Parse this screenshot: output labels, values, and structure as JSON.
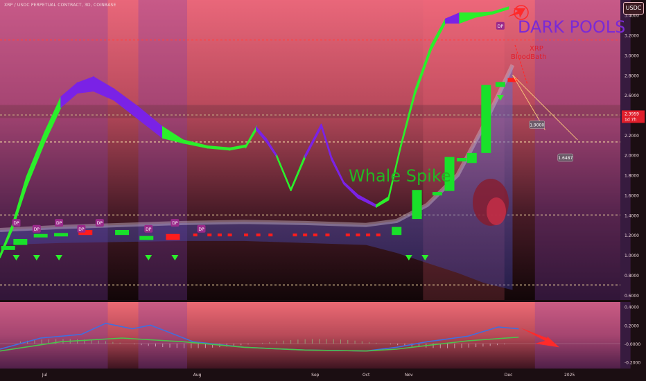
{
  "header": {
    "title": "XRP / USDC PERPETUAL CONTRACT, 3D, COINBASE",
    "currency": "USDC"
  },
  "annotations": {
    "dark_pools": "DARK POOLS",
    "xrp": "XRP",
    "bloodbath": "BloodBath",
    "whale_spike": "Whale Spike",
    "dp": "DP"
  },
  "price_badge": {
    "value": "2.3959",
    "sub": "1d 7h",
    "color": "#e01e2b"
  },
  "colors": {
    "bull": "#19e02a",
    "bear": "#ff1c1c",
    "ribbon_up": "#2bef2b",
    "ribbon_down": "#7a22e6",
    "signal": "#2bef2b"
  },
  "chart_data": [
    {
      "type": "line",
      "name": "main",
      "x_labels": [
        "Jul",
        "Aug",
        "Sep",
        "Oct",
        "Nov",
        "Dec",
        "2025"
      ],
      "y_ticks": [
        0.6,
        0.8,
        1.0,
        1.2,
        1.4,
        1.6,
        1.8,
        2.0,
        2.2,
        2.4,
        2.6,
        2.8,
        3.0,
        3.2,
        3.4
      ],
      "y_tick_labels": [
        "0.6000",
        "0.8000",
        "1.0000",
        "1.2000",
        "1.4000",
        "1.6000",
        "1.8000",
        "2.0000",
        "2.2000",
        "2.4000",
        "2.6000",
        "2.8000",
        "3.0000",
        "3.2000",
        "3.4000"
      ],
      "ylim": [
        0.55,
        3.55
      ],
      "candles": [
        {
          "x": 0.4,
          "o": 1.05,
          "c": 1.09
        },
        {
          "x": 1.0,
          "o": 1.1,
          "c": 1.16
        },
        {
          "x": 2.0,
          "o": 1.19,
          "c": 1.21
        },
        {
          "x": 3.0,
          "o": 1.21,
          "c": 1.22
        },
        {
          "x": 4.2,
          "o": 1.25,
          "c": 1.2
        },
        {
          "x": 6.0,
          "o": 1.2,
          "c": 1.25
        },
        {
          "x": 7.2,
          "o": 1.15,
          "c": 1.19
        },
        {
          "x": 8.5,
          "o": 1.21,
          "c": 1.15
        },
        {
          "x": 19.5,
          "o": 1.2,
          "c": 1.28
        },
        {
          "x": 20.5,
          "o": 1.36,
          "c": 1.65
        },
        {
          "x": 21.5,
          "o": 1.6,
          "c": 1.63
        },
        {
          "x": 22.1,
          "o": 1.64,
          "c": 1.98
        },
        {
          "x": 22.7,
          "o": 1.94,
          "c": 1.97
        },
        {
          "x": 23.2,
          "o": 1.92,
          "c": 2.02
        },
        {
          "x": 23.9,
          "o": 2.02,
          "c": 2.7
        },
        {
          "x": 24.6,
          "o": 2.68,
          "c": 2.73
        },
        {
          "x": 25.2,
          "o": 2.77,
          "c": 2.73
        }
      ],
      "small_bears": [
        9.6,
        10.3,
        10.8,
        11.3,
        12.1,
        12.7,
        13.3,
        14.5,
        15.0,
        15.5,
        16.1,
        17.1,
        17.6,
        18.1,
        18.6
      ],
      "hlines": [
        {
          "y": 3.15,
          "color": "#ff4040"
        },
        {
          "y": 2.4,
          "color": "#f0d5a0"
        },
        {
          "y": 2.13,
          "color": "#f0d5a0"
        },
        {
          "y": 1.4,
          "color": "#f0d5a0"
        },
        {
          "y": 0.7,
          "color": "#f0d5a0"
        }
      ],
      "targets": [
        {
          "label": "1.9000",
          "x": 26.4,
          "y": 2.3
        },
        {
          "label": "1.6487",
          "x": 27.8,
          "y": 1.97
        }
      ],
      "ribbon_upper": [
        [
          0,
          1.0
        ],
        [
          0.6,
          1.3
        ],
        [
          1.3,
          1.78
        ],
        [
          2.2,
          2.23
        ],
        [
          3.0,
          2.58
        ],
        [
          3.8,
          2.72
        ],
        [
          4.6,
          2.78
        ],
        [
          5.6,
          2.66
        ],
        [
          6.8,
          2.48
        ],
        [
          8.0,
          2.28
        ],
        [
          9.0,
          2.15
        ],
        [
          10.2,
          2.09
        ],
        [
          11.3,
          2.07
        ],
        [
          12.1,
          2.1
        ],
        [
          12.6,
          2.28
        ],
        [
          13.1,
          2.16
        ],
        [
          13.6,
          2.0
        ],
        [
          14.3,
          1.66
        ],
        [
          15.0,
          2.0
        ],
        [
          15.8,
          2.31
        ],
        [
          16.3,
          1.98
        ],
        [
          16.9,
          1.73
        ],
        [
          17.6,
          1.6
        ],
        [
          18.5,
          1.5
        ],
        [
          19.1,
          1.58
        ],
        [
          19.7,
          2.1
        ],
        [
          20.4,
          2.65
        ],
        [
          21.2,
          3.1
        ],
        [
          21.9,
          3.36
        ],
        [
          22.6,
          3.42
        ],
        [
          23.4,
          3.42
        ],
        [
          24.2,
          3.43
        ],
        [
          25.0,
          3.48
        ]
      ],
      "ribbon_lower": [
        [
          0,
          0.97
        ],
        [
          0.6,
          1.25
        ],
        [
          1.3,
          1.68
        ],
        [
          2.2,
          2.13
        ],
        [
          3.0,
          2.48
        ],
        [
          3.8,
          2.62
        ],
        [
          4.6,
          2.64
        ],
        [
          5.6,
          2.55
        ],
        [
          6.8,
          2.36
        ],
        [
          8.0,
          2.17
        ],
        [
          9.0,
          2.12
        ],
        [
          10.2,
          2.07
        ],
        [
          11.3,
          2.05
        ],
        [
          12.1,
          2.08
        ],
        [
          12.6,
          2.25
        ],
        [
          13.1,
          2.13
        ],
        [
          13.6,
          1.98
        ],
        [
          14.3,
          1.64
        ],
        [
          15.0,
          1.97
        ],
        [
          15.8,
          2.28
        ],
        [
          16.3,
          1.95
        ],
        [
          16.9,
          1.71
        ],
        [
          17.6,
          1.57
        ],
        [
          18.5,
          1.48
        ],
        [
          19.1,
          1.55
        ],
        [
          19.7,
          2.07
        ],
        [
          20.4,
          2.6
        ],
        [
          21.2,
          3.05
        ],
        [
          21.9,
          3.32
        ],
        [
          22.6,
          3.32
        ],
        [
          23.4,
          3.38
        ],
        [
          24.2,
          3.41
        ],
        [
          25.0,
          3.46
        ]
      ],
      "ribbon_colors": [
        "up",
        "up",
        "up",
        "up",
        "down",
        "down",
        "down",
        "down",
        "down",
        "up",
        "up",
        "up",
        "up",
        "up",
        "down",
        "down",
        "up",
        "up",
        "down",
        "down",
        "down",
        "down",
        "down",
        "up",
        "up",
        "up",
        "up",
        "up",
        "down",
        "up",
        "up",
        "up"
      ],
      "band_upper": [
        [
          0,
          1.25
        ],
        [
          3,
          1.28
        ],
        [
          6,
          1.3
        ],
        [
          9,
          1.32
        ],
        [
          12,
          1.33
        ],
        [
          15,
          1.32
        ],
        [
          18,
          1.3
        ],
        [
          19.5,
          1.34
        ],
        [
          21,
          1.5
        ],
        [
          22.5,
          1.8
        ],
        [
          23.8,
          2.3
        ],
        [
          25.2,
          2.9
        ]
      ],
      "band_lower": [
        [
          0,
          1.1
        ],
        [
          3,
          1.12
        ],
        [
          6,
          1.13
        ],
        [
          9,
          1.14
        ],
        [
          12,
          1.14
        ],
        [
          15,
          1.12
        ],
        [
          18,
          1.1
        ],
        [
          19.5,
          1.02
        ],
        [
          21,
          0.92
        ],
        [
          22.5,
          0.82
        ],
        [
          23.8,
          0.72
        ],
        [
          25.2,
          0.65
        ]
      ]
    },
    {
      "type": "line",
      "name": "oscillator",
      "y_ticks": [
        0.4,
        0.2,
        0.0,
        -0.2
      ],
      "y_tick_labels": [
        "0.4000",
        "0.2000",
        "-0.0000",
        "-0.2000"
      ],
      "ylim": [
        -0.27,
        0.45
      ],
      "series": [
        {
          "color": "#3f6fe0",
          "points": [
            [
              0,
              -0.06
            ],
            [
              2,
              0.06
            ],
            [
              4,
              0.1
            ],
            [
              5.2,
              0.22
            ],
            [
              6.5,
              0.16
            ],
            [
              7.4,
              0.2
            ],
            [
              9.5,
              0.02
            ],
            [
              12,
              -0.04
            ],
            [
              15,
              -0.07
            ],
            [
              18,
              -0.08
            ],
            [
              19.5,
              -0.04
            ],
            [
              21,
              0.02
            ],
            [
              23,
              0.08
            ],
            [
              24.5,
              0.18
            ],
            [
              25.5,
              0.16
            ]
          ]
        },
        {
          "color": "#4cc24c",
          "points": [
            [
              0,
              -0.08
            ],
            [
              3,
              0.02
            ],
            [
              6,
              0.06
            ],
            [
              9,
              0.02
            ],
            [
              12,
              -0.04
            ],
            [
              15,
              -0.07
            ],
            [
              18,
              -0.08
            ],
            [
              19.5,
              -0.06
            ],
            [
              21,
              -0.02
            ],
            [
              23,
              0.03
            ],
            [
              25.5,
              0.07
            ]
          ]
        }
      ]
    }
  ]
}
